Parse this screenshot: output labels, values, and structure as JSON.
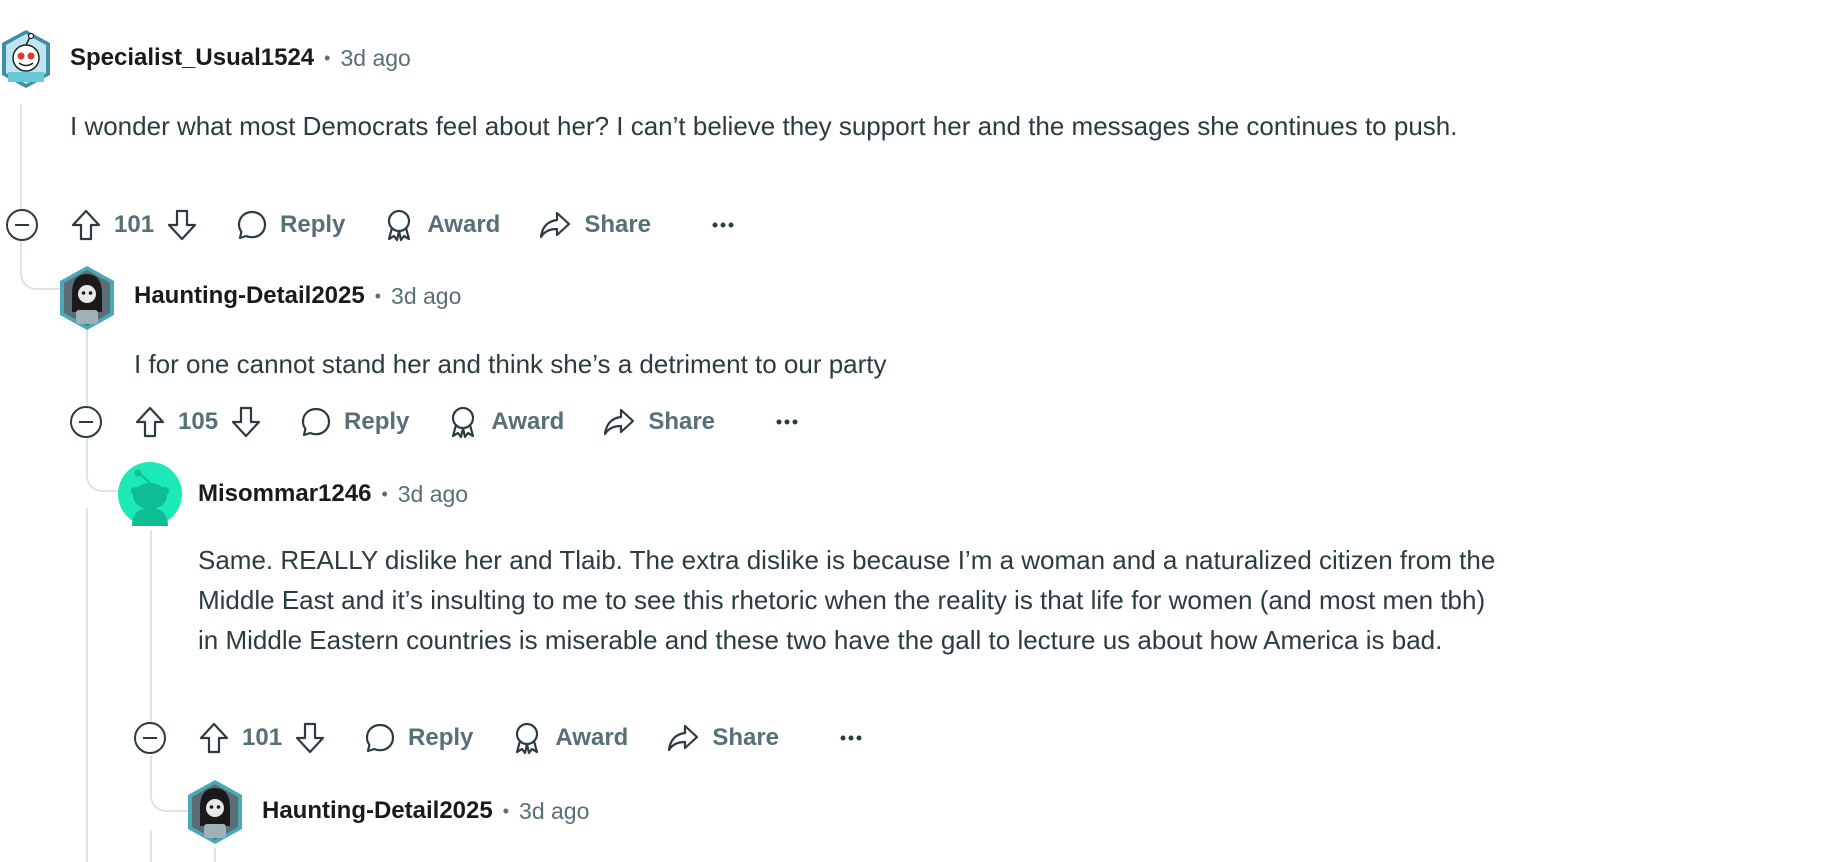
{
  "comments": [
    {
      "username": "Specialist_Usual1524",
      "time": "3d ago",
      "body": "I wonder what most Democrats feel about her? I can’t believe they support her and the messages she continues to push.",
      "score": "101",
      "reply_label": "Reply",
      "award_label": "Award",
      "share_label": "Share",
      "avatar": "snoo-avatar"
    },
    {
      "username": "Haunting-Detail2025",
      "time": "3d ago",
      "body": "I for one cannot stand her and think she’s a detriment to our party",
      "score": "105",
      "reply_label": "Reply",
      "award_label": "Award",
      "share_label": "Share",
      "avatar": "hooded-snoo-avatar"
    },
    {
      "username": "Misommar1246",
      "time": "3d ago",
      "body": "Same. REALLY dislike her and Tlaib. The extra dislike is because I’m a woman and a naturalized citizen from the Middle East and it’s insulting to me to see this rhetoric when the reality is that life for women (and most men tbh) in Middle Eastern countries is miserable and these two have the gall to lecture us about how America is bad.",
      "score": "101",
      "reply_label": "Reply",
      "award_label": "Award",
      "share_label": "Share",
      "avatar": "default-snoo-avatar"
    },
    {
      "username": "Haunting-Detail2025",
      "time": "3d ago",
      "avatar": "hooded-snoo-avatar"
    }
  ],
  "separator": "•",
  "colors": {
    "meta_text": "#576f76",
    "body_text": "#2a3c42",
    "thread_line": "#dfe3e6",
    "default_avatar": "#1de9b6"
  }
}
